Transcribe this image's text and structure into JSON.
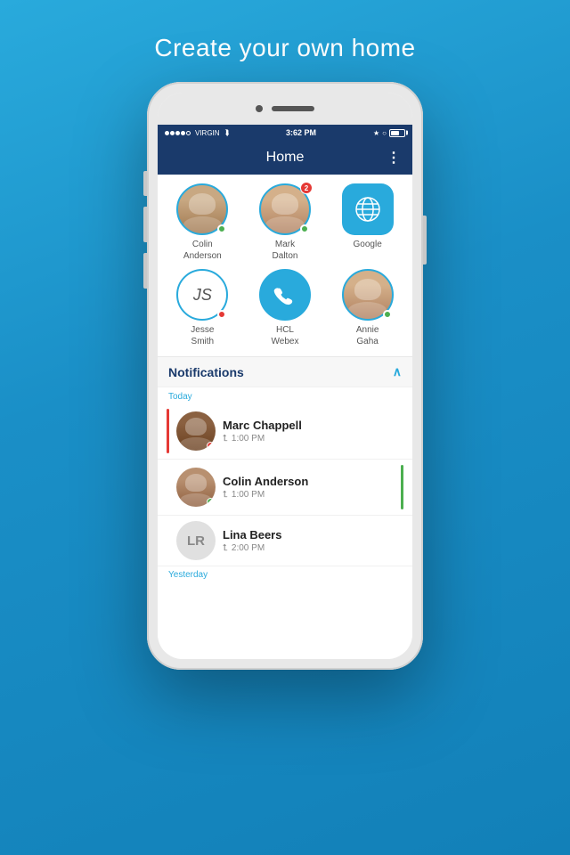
{
  "page": {
    "headline": "Create your own home"
  },
  "status_bar": {
    "carrier": "VIRGIN",
    "time": "3:62 PM"
  },
  "nav": {
    "title": "Home",
    "menu_dots": "⋮"
  },
  "contacts": [
    {
      "id": "colin-anderson",
      "name": "Colin\nAnderson",
      "initials": "",
      "type": "person",
      "status": "green",
      "badge": null
    },
    {
      "id": "mark-dalton",
      "name": "Mark\nDalton",
      "initials": "",
      "type": "person",
      "status": "green",
      "badge": "2"
    },
    {
      "id": "google",
      "name": "Google",
      "initials": "",
      "type": "globe",
      "status": null,
      "badge": null
    },
    {
      "id": "jesse-smith",
      "name": "Jesse\nSmith",
      "initials": "JS",
      "type": "initials",
      "status": "red",
      "badge": null
    },
    {
      "id": "hcl-webex",
      "name": "HCL\nWebex",
      "initials": "",
      "type": "phone",
      "status": null,
      "badge": null
    },
    {
      "id": "annie-gaha",
      "name": "Annie\nGaha",
      "initials": "",
      "type": "person",
      "status": "green",
      "badge": null
    }
  ],
  "notifications": {
    "section_title": "Notifications",
    "chevron": "∧",
    "date_today": "Today",
    "date_yesterday": "Yesterday",
    "items": [
      {
        "id": "marc-chappell",
        "name": "Marc Chappell",
        "time": "1:00 PM",
        "avatar_type": "person",
        "avatar_color": "dark",
        "dot_color": "red",
        "left_bar": "red"
      },
      {
        "id": "colin-anderson-notif",
        "name": "Colin Anderson",
        "time": "1:00 PM",
        "avatar_type": "person",
        "avatar_color": "medium",
        "dot_color": "green",
        "left_bar": null,
        "right_bar": "green"
      },
      {
        "id": "lina-beers",
        "name": "Lina Beers",
        "time": "2:00 PM",
        "avatar_type": "initials",
        "initials": "LR",
        "dot_color": null,
        "left_bar": null
      }
    ]
  }
}
